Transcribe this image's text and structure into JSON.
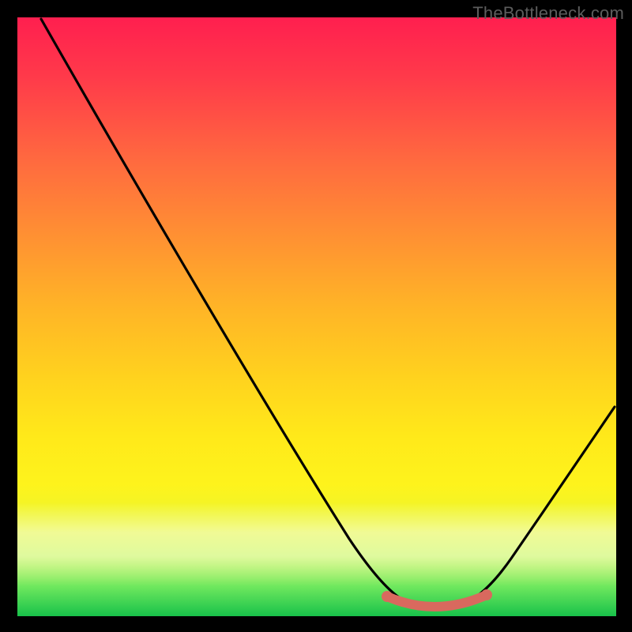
{
  "watermark": "TheBottleneck.com",
  "chart_data": {
    "type": "line",
    "title": "",
    "xlabel": "",
    "ylabel": "",
    "xlim": [
      0,
      100
    ],
    "ylim": [
      0,
      100
    ],
    "grid": false,
    "legend": false,
    "series": [
      {
        "name": "bottleneck-curve",
        "x": [
          4,
          10,
          20,
          30,
          40,
          50,
          57,
          62,
          66,
          70,
          74,
          78,
          84,
          90,
          96,
          100
        ],
        "values": [
          99,
          89,
          74,
          59,
          44,
          29,
          16,
          8,
          3,
          1,
          1,
          2,
          7,
          16,
          27,
          35
        ]
      },
      {
        "name": "optimal-zone",
        "x": [
          62,
          66,
          70,
          74,
          78
        ],
        "values": [
          2.5,
          1.3,
          1.0,
          1.3,
          2.5
        ]
      }
    ],
    "colors": {
      "curve": "#000000",
      "optimal_zone": "#d9695e",
      "gradient_top": "#ff1f4f",
      "gradient_mid": "#ffe91a",
      "gradient_bottom": "#18c24a"
    }
  }
}
